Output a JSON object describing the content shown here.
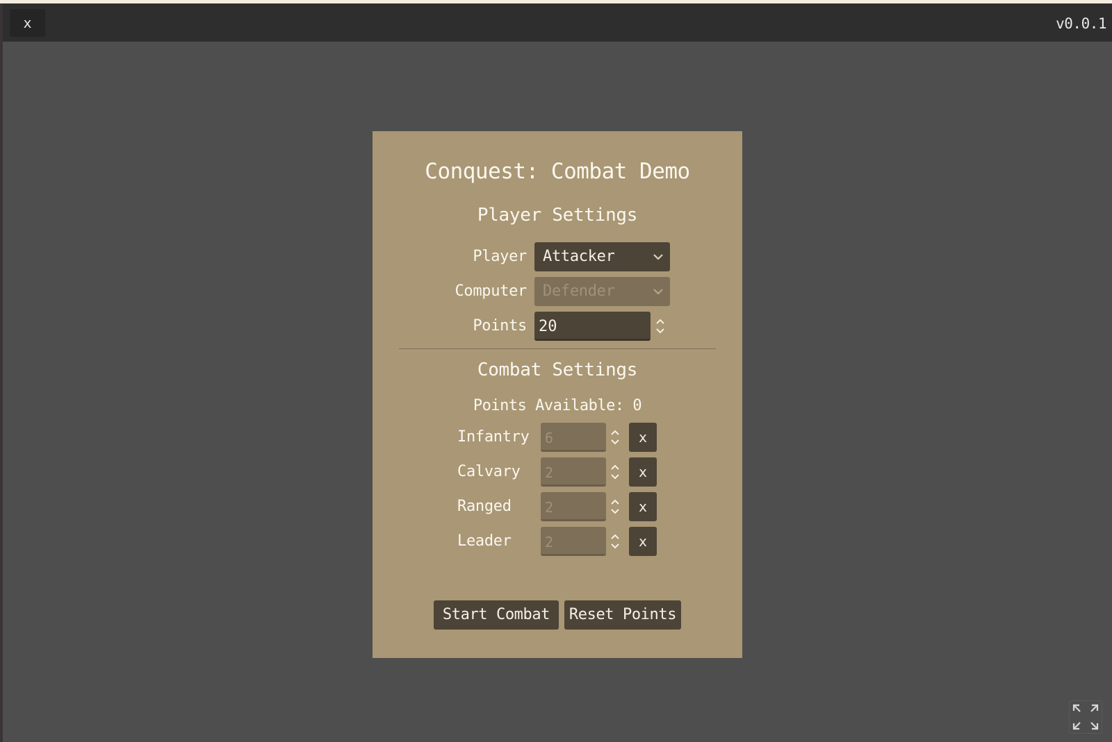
{
  "topbar": {
    "close_label": "x",
    "version": "v0.0.1"
  },
  "panel": {
    "title": "Conquest: Combat Demo",
    "player_settings": {
      "heading": "Player Settings",
      "player_label": "Player",
      "player_value": "Attacker",
      "computer_label": "Computer",
      "computer_value": "Defender",
      "points_label": "Points",
      "points_value": "20"
    },
    "combat_settings": {
      "heading": "Combat Settings",
      "points_available": "Points Available: 0",
      "units": [
        {
          "label": "Infantry",
          "value": "6",
          "clear": "x"
        },
        {
          "label": "Calvary",
          "value": "2",
          "clear": "x"
        },
        {
          "label": "Ranged",
          "value": "2",
          "clear": "x"
        },
        {
          "label": "Leader",
          "value": "2",
          "clear": "x"
        }
      ]
    },
    "actions": {
      "start": "Start Combat",
      "reset": "Reset Points"
    }
  },
  "icons": {
    "dropdown": "chevron-down-icon",
    "spinner": "spinner-arrows-icon",
    "fullscreen": "fullscreen-icon"
  }
}
